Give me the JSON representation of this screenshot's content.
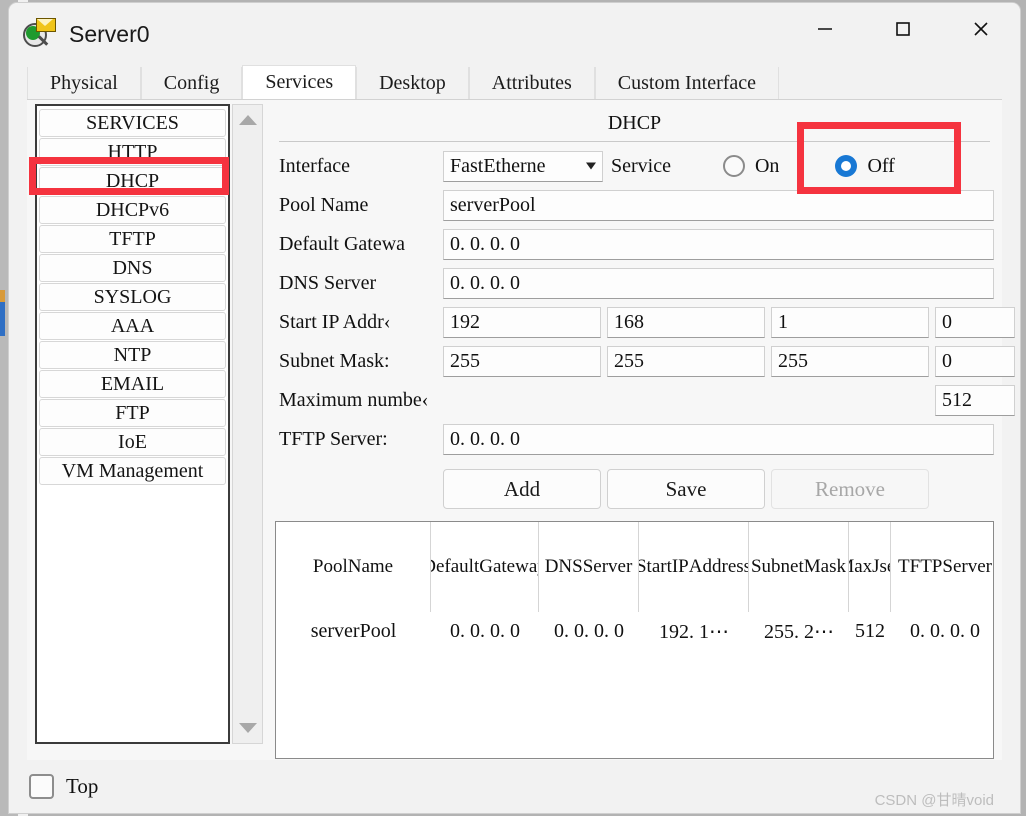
{
  "window": {
    "title": "Server0",
    "icon": "server-magnifier-envelope-icon",
    "controls": {
      "minimize": "—",
      "maximize": "☐",
      "close": "✕"
    }
  },
  "tabs": [
    {
      "label": "Physical",
      "active": false
    },
    {
      "label": "Config",
      "active": false
    },
    {
      "label": "Services",
      "active": true
    },
    {
      "label": "Desktop",
      "active": false
    },
    {
      "label": "Attributes",
      "active": false
    },
    {
      "label": "Custom Interface",
      "active": false
    }
  ],
  "sidebar": {
    "items": [
      {
        "label": "SERVICES",
        "highlighted": false
      },
      {
        "label": "HTTP",
        "highlighted": false
      },
      {
        "label": "DHCP",
        "highlighted": true
      },
      {
        "label": "DHCPv6",
        "highlighted": false
      },
      {
        "label": "TFTP",
        "highlighted": false
      },
      {
        "label": "DNS",
        "highlighted": false
      },
      {
        "label": "SYSLOG",
        "highlighted": false
      },
      {
        "label": "AAA",
        "highlighted": false
      },
      {
        "label": "NTP",
        "highlighted": false
      },
      {
        "label": "EMAIL",
        "highlighted": false
      },
      {
        "label": "FTP",
        "highlighted": false
      },
      {
        "label": "IoE",
        "highlighted": false
      },
      {
        "label": "VM Management",
        "highlighted": false
      }
    ],
    "scrollbar": {
      "up": "scroll-up-arrow",
      "down": "scroll-down-arrow"
    }
  },
  "panel": {
    "title": "DHCP",
    "interface": {
      "label": "Interface",
      "value": "FastEtherne",
      "service_label": "Service",
      "on_label": "On",
      "off_label": "Off",
      "selected": "Off"
    },
    "pool_name": {
      "label": "Pool Name",
      "value": "serverPool"
    },
    "default_gateway": {
      "label": "Default Gatewa",
      "value": "0. 0. 0. 0"
    },
    "dns_server": {
      "label": "DNS Server",
      "value": "0. 0. 0. 0"
    },
    "start_ip": {
      "label": "Start IP Addr‹",
      "o1": "192",
      "o2": "168",
      "o3": "1",
      "o4": "0"
    },
    "subnet_mask": {
      "label": "Subnet Mask:",
      "o1": "255",
      "o2": "255",
      "o3": "255",
      "o4": "0"
    },
    "max_users": {
      "label": "Maximum numbe‹",
      "value": "512"
    },
    "tftp_server": {
      "label": "TFTP Server:",
      "value": "0. 0. 0. 0"
    },
    "buttons": {
      "add": "Add",
      "save": "Save",
      "remove": "Remove",
      "remove_disabled": true
    },
    "table": {
      "headers": [
        "Pool\nName",
        "Default\nGateway",
        "DNS\nServer",
        "Start\nIP\nAddress",
        "Subnet\nMask",
        "Max\nJser",
        "TFTP\nServer"
      ],
      "rows": [
        [
          "serverPool",
          "0. 0. 0. 0",
          "0. 0. 0. 0",
          "192. 1⋯",
          "255. 2⋯",
          "512",
          "0. 0. 0. 0"
        ]
      ]
    }
  },
  "footer": {
    "top_checkbox_label": "Top",
    "top_checked": false,
    "watermark": "CSDN @甘晴void"
  },
  "colors": {
    "annotation_red": "#f5333f",
    "radio_blue": "#1878d4",
    "window_bg": "#f2f2f2",
    "panel_bg": "#f7f7f7"
  }
}
